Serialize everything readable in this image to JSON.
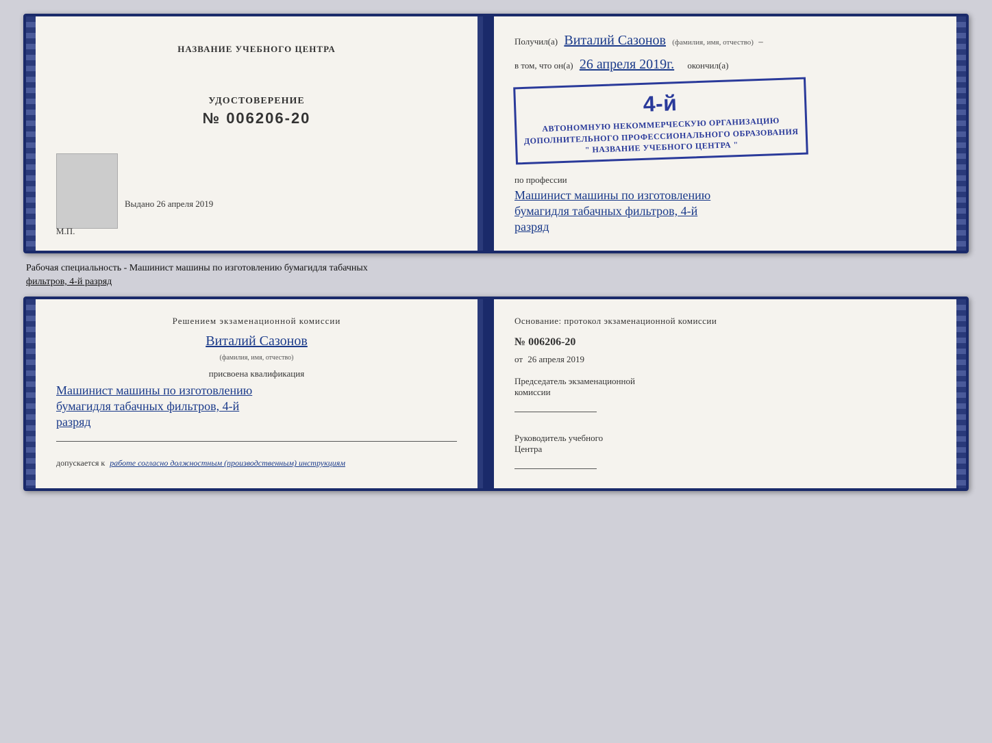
{
  "top_book": {
    "left": {
      "title": "НАЗВАНИЕ УЧЕБНОГО ЦЕНТРА",
      "photo_alt": "фото",
      "udostoverenie_label": "УДОСТОВЕРЕНИЕ",
      "udostoverenie_num": "№ 006206-20",
      "vydano_label": "Выдано",
      "vydano_date": "26 апреля 2019",
      "mp_label": "М.П."
    },
    "right": {
      "poluchil_prefix": "Получил(а)",
      "name": "Виталий Сазонов",
      "name_subtitle": "(фамилия, имя, отчество)",
      "vtom_prefix": "в том, что он(а)",
      "vtom_date": "26 апреля 2019г.",
      "okonchil": "окончил(а)",
      "stamp_4": "4-й",
      "stamp_line1": "АВТОНОМНУЮ НЕКОММЕРЧЕСКУЮ ОРГАНИЗАЦИЮ",
      "stamp_line2": "ДОПОЛНИТЕЛЬНОГО ПРОФЕССИОНАЛЬНОГО ОБРАЗОВАНИЯ",
      "stamp_line3": "\" НАЗВАНИЕ УЧЕБНОГО ЦЕНТРА \"",
      "po_professii": "по профессии",
      "profession_line1": "Машинист машины по изготовлению",
      "profession_line2": "бумагидля табачных фильтров, 4-й",
      "profession_line3": "разряд"
    }
  },
  "spec_label": {
    "text1": "Рабочая специальность - Машинист машины по изготовлению бумагидля табачных",
    "text2": "фильтров, 4-й разряд"
  },
  "bottom_book": {
    "left": {
      "resheniem_title": "Решением  экзаменационной  комиссии",
      "name": "Виталий Сазонов",
      "name_subtitle": "(фамилия, имя, отчество)",
      "prisvoena": "присвоена квалификация",
      "qual_line1": "Машинист машины по изготовлению",
      "qual_line2": "бумагидля табачных фильтров, 4-й",
      "qual_line3": "разряд",
      "dopuskaetsya_prefix": "допускается к",
      "dopuskaetsya_text": "работе согласно должностным (производственным) инструкциям"
    },
    "right": {
      "osnovanie": "Основание: протокол экзаменационной  комиссии",
      "nom": "№  006206-20",
      "ot_prefix": "от",
      "ot_date": "26 апреля 2019",
      "predsedatel_line1": "Председатель экзаменационной",
      "predsedatel_line2": "комиссии",
      "rukovoditel_line1": "Руководитель учебного",
      "rukovoditel_line2": "Центра"
    }
  }
}
